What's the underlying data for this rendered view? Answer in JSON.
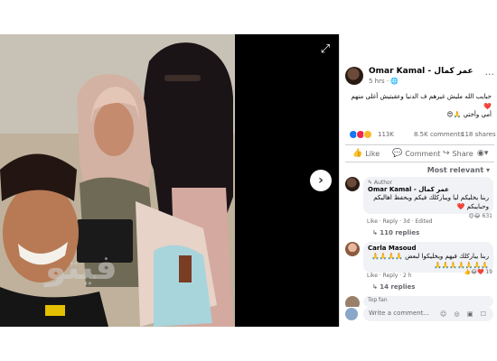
{
  "post": {
    "author": "Omar Kamal - عمر كمال",
    "time": "5 hrs · 🌐",
    "text_line1": "حبايب الله مليش غيرهم ف الدنيا وعقبتيش أغلى منهم ❤️",
    "text_line2": "أمي وأختي 🙏😍",
    "reaction_count": "113K",
    "comments_count": "8.5K comments",
    "shares_count": "118 shares",
    "actions": {
      "like": "Like",
      "comment": "Comment",
      "share": "Share"
    },
    "sort": "Most relevant ▾"
  },
  "topbar": {
    "add": "+",
    "messenger": "✉",
    "notifications": "🔔",
    "account": "▾"
  },
  "viewer": {
    "watermark": "فيتو",
    "next": "›",
    "expand": "⤢"
  },
  "comments": [
    {
      "badge": "✎ Author",
      "name": "Omar Kamal - عمر كمال",
      "text": "ربنا يخليكم ليا ويباركلك فيكم ويحفظ اهاليكم وحبايبكم ❤️",
      "meta": "Like · Reply · 3d · Edited",
      "reactions": "😍😂 631",
      "replies": "↳ 110 replies"
    },
    {
      "name": "Carla Masoud",
      "text": "ربنا يباركلك فيهم ويخليكوا لبعض 🙏🙏🙏🙏🙏🙏🙏🙏🙏🙏🙏",
      "meta": "Like · Reply · 2 h",
      "reactions": "👍😂❤️ 19",
      "replies": "↳ 14 replies"
    },
    {
      "badge": "Top fan"
    }
  ],
  "comment_box": {
    "placeholder": "Write a comment...",
    "icons": "☺ ◎ ▣ ☐"
  },
  "colors": {
    "accent": "#1877f2",
    "text": "#050505",
    "muted": "#65676b",
    "bubble": "#f0f2f5"
  }
}
